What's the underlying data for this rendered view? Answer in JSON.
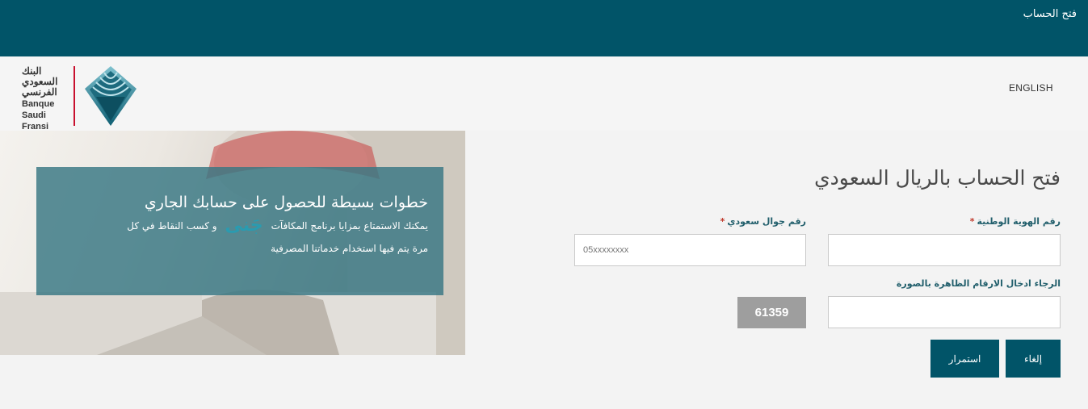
{
  "topbar": {
    "title": "فتح الحساب"
  },
  "header": {
    "logo_arabic_lines": [
      "البنك",
      "السعودي",
      "الفرنسي"
    ],
    "logo_latin_lines": [
      "Banque",
      "Saudi",
      "Fransi"
    ],
    "language_link": "ENGLISH"
  },
  "promo": {
    "title": "خطوات بسيطة للحصول على حسابك الجاري",
    "line1_before": "يمكنك الاستمتاع بمزايا برنامج المكافآت",
    "brand": "جَنى",
    "line1_after": "و كسب النقاط في كل",
    "line2": "مرة يتم فيها استخدام خدماتنا المصرفية"
  },
  "form": {
    "title": "فتح الحساب بالريال السعودي",
    "national_id_label": "رقم الهوية الوطنية",
    "mobile_label": "رقم جوال سعودي",
    "required_mark": "*",
    "mobile_placeholder": "05xxxxxxxx",
    "captcha_instruction": "الرجاء ادخال الارقام الظاهرة بالصورة",
    "captcha_code": "61359",
    "cancel_label": "إلغاء",
    "continue_label": "استمرار"
  },
  "colors": {
    "brand_primary": "#015468",
    "required": "#c0392b",
    "logo_accent": "#c8102e"
  },
  "icons": [
    "bank-logo-icon"
  ]
}
